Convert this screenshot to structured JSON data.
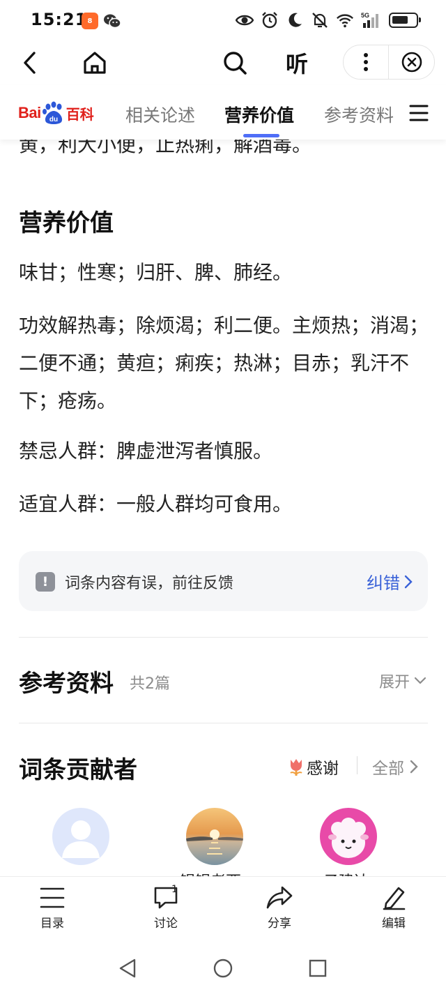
{
  "status_bar": {
    "time": "15:21",
    "app_badge": "8",
    "network": "5G",
    "icons": [
      "eye-icon",
      "alarm-icon",
      "moon-icon",
      "bell-off-icon",
      "wifi-icon",
      "signal-icon",
      "battery-icon"
    ]
  },
  "toolbar": {
    "listen_label": "听",
    "icons": [
      "back-icon",
      "home-icon",
      "search-icon",
      "more-icon",
      "close-icon"
    ]
  },
  "tabbar": {
    "logo_bai": "Bai",
    "logo_du": "du",
    "logo_ke": "百科",
    "tabs": [
      {
        "label": "相关论述",
        "active": false
      },
      {
        "label": "营养价值",
        "active": true
      },
      {
        "label": "参考资料",
        "active": false
      }
    ]
  },
  "content": {
    "clipped_paragraph": "黄，利大小便，止热痢，解酒毒。",
    "section_title": "营养价值",
    "paragraphs": [
      "味甘；性寒；归肝、脾、肺经。",
      "功效解热毒；除烦渴；利二便。主烦热；消渴；二便不通；黄疸；痢疾；热淋；目赤；乳汗不下；疮疡。",
      "禁忌人群：脾虚泄泻者慎服。",
      "适宜人群：一般人群均可食用。"
    ],
    "feedback": {
      "text": "词条内容有误，前往反馈",
      "link": "纠错",
      "icon_glyph": "!"
    },
    "references": {
      "title": "参考资料",
      "count": "共2篇",
      "expand": "展开"
    },
    "contributors": {
      "title": "词条贡献者",
      "thanks": "感谢",
      "all": "全部",
      "names": [
        "",
        "锅锅老西",
        "子建达"
      ]
    }
  },
  "bottom_nav": {
    "items": [
      {
        "label": "目录",
        "icon": "list-icon"
      },
      {
        "label": "讨论",
        "icon": "comment-icon",
        "badge": "1"
      },
      {
        "label": "分享",
        "icon": "share-icon"
      },
      {
        "label": "编辑",
        "icon": "edit-icon"
      }
    ]
  },
  "colors": {
    "brand_red": "#e0201b",
    "brand_blue": "#2c57d8",
    "link_blue": "#3a62d8",
    "tab_indicator": "#4f6ef7"
  }
}
